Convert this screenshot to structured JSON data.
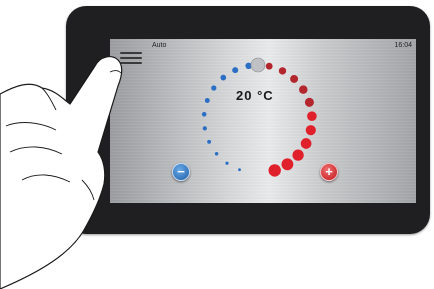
{
  "status_bar": {
    "mode": "Auto",
    "time": "16:04"
  },
  "thermostat": {
    "temperature": "20 °C",
    "decrease_symbol": "−",
    "increase_symbol": "+",
    "cold_color": "#2a6fc4",
    "warm_color": "#e0202b"
  },
  "icons": {
    "menu": "menu-icon",
    "decrease": "minus-icon",
    "increase": "plus-icon",
    "knob": "dial-knob"
  }
}
